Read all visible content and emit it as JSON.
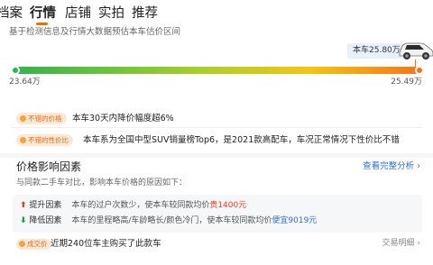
{
  "tabs": [
    {
      "label": "档案"
    },
    {
      "label": "行情",
      "active": true
    },
    {
      "label": "店铺"
    },
    {
      "label": "实拍"
    },
    {
      "label": "推荐"
    }
  ],
  "subtitle": "基于检测信息及行情大数据预估本车估价区间",
  "price_tag": "本车25.80万",
  "range": {
    "min": "23.64万",
    "max": "25.49万"
  },
  "info_rows": [
    {
      "badge": "不错的价格",
      "text": "本车30天内降价幅度超6%"
    },
    {
      "badge": "不错的性价比",
      "text": "本车系为全国中型SUV销量榜Top6，是2021款高配车，车况正常情况下性价比不错"
    }
  ],
  "section": {
    "title": "价格影响因素",
    "link": "查看完整分析 ›",
    "subtitle": "与同款二手车对比，影响本车价格的原因如下："
  },
  "factors": [
    {
      "arrow": "⬆",
      "title": "提升因素",
      "desc": "本车的过户次数少，使本车较同款均价",
      "highlight": "贵1400元"
    },
    {
      "arrow": "⬇",
      "title": "降低因素",
      "desc": "本车的里程略高/车龄略长/颜色冷门，使本车较同款均价",
      "highlight": "便宜9019元"
    }
  ],
  "deal": {
    "badge": "成交价",
    "text": "近期240位车主购买了此款车",
    "link": "交易明细 ›"
  },
  "colors": {
    "accent": "#ff6a00",
    "link": "#2f6fd4",
    "up": "#e8401c",
    "down": "#1e9a48"
  }
}
